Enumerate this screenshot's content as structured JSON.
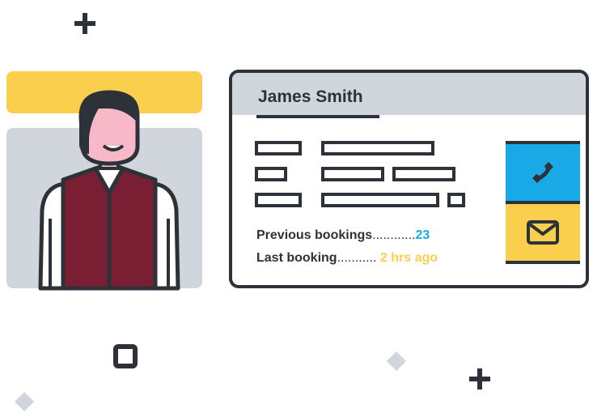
{
  "customer": {
    "name": "James Smith",
    "previous_bookings_label": "Previous bookings",
    "previous_bookings_dots": "............",
    "previous_bookings_value": "23",
    "last_booking_label": "Last booking",
    "last_booking_dots": "...........",
    "last_booking_value": "2 hrs ago"
  },
  "actions": {
    "call_icon": "phone-icon",
    "email_icon": "envelope-icon"
  },
  "colors": {
    "accent_blue": "#19a9e6",
    "accent_yellow": "#f9cf4d",
    "dark": "#2d3238",
    "panel_grey": "#d0d6db",
    "vest_maroon": "#7a1f33",
    "skin": "#f7b8c8"
  }
}
